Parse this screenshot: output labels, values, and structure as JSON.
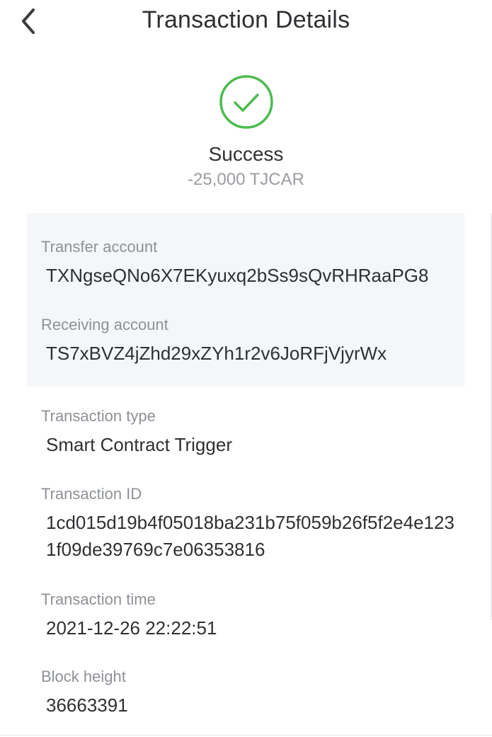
{
  "header": {
    "title": "Transaction Details",
    "back_icon": "chevron-left-icon"
  },
  "status": {
    "icon": "check-circle-icon",
    "label": "Success",
    "amount": "-25,000 TJCAR",
    "color": "#4cbb4f"
  },
  "accounts": {
    "transfer_label": "Transfer account",
    "transfer_value": "TXNgseQNo6X7EKyuxq2bSs9sQvRHRaaPG8",
    "receiving_label": "Receiving account",
    "receiving_value": "TS7xBVZ4jZhd29xZYh1r2v6JoRFjVjyrWx"
  },
  "details": {
    "type_label": "Transaction type",
    "type_value": "Smart Contract Trigger",
    "id_label": "Transaction ID",
    "id_value": "1cd015d19b4f05018ba231b75f059b26f5f2e4e1231f09de39769c7e06353816",
    "time_label": "Transaction time",
    "time_value": "2021-12-26 22:22:51",
    "block_label": "Block height",
    "block_value": "36663391"
  }
}
